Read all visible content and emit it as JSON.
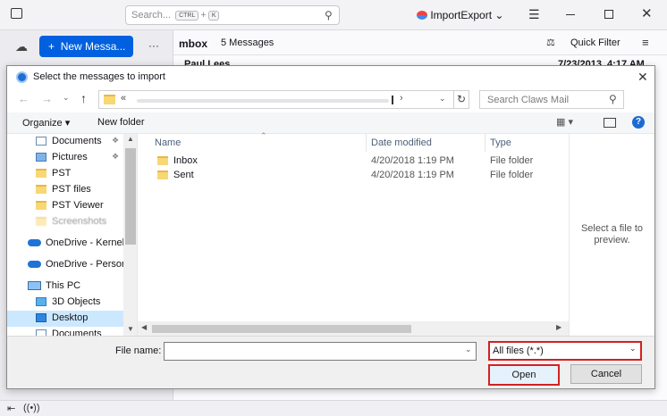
{
  "app": {
    "search_placeholder": "Search...",
    "kbd_ctrl": "CTRL",
    "kbd_plus": "+",
    "kbd_k": "K",
    "account_label": "ImportExport",
    "new_message": "New Messa...",
    "more": "···",
    "folder_name": "mbox",
    "message_count": "5 Messages",
    "quick_filter": "Quick Filter",
    "sender": "Paul Lees",
    "date": "7/23/2013, 4:17 AM"
  },
  "dialog": {
    "title": "Select the messages to import",
    "search_placeholder": "Search Claws Mail",
    "address_prefix": "«",
    "organize": "Organize",
    "new_folder": "New folder",
    "nav_items": [
      {
        "label": "Documents",
        "pinned": "true"
      },
      {
        "label": "Pictures",
        "pinned": "true"
      },
      {
        "label": "PST"
      },
      {
        "label": "PST files"
      },
      {
        "label": "PST Viewer"
      },
      {
        "label": "Screenshots"
      },
      {
        "label": "OneDrive - Kernel"
      },
      {
        "label": "OneDrive - Person"
      },
      {
        "label": "This PC"
      },
      {
        "label": "3D Objects"
      },
      {
        "label": "Desktop"
      },
      {
        "label": "Documents"
      }
    ],
    "columns": {
      "name": "Name",
      "date": "Date modified",
      "type": "Type"
    },
    "files": [
      {
        "name": "Inbox",
        "date": "4/20/2018 1:19 PM",
        "type": "File folder"
      },
      {
        "name": "Sent",
        "date": "4/20/2018 1:19 PM",
        "type": "File folder"
      }
    ],
    "preview_text": "Select a file to preview.",
    "file_name_label": "File name:",
    "file_name_value": "",
    "filter_value": "All files (*.*)",
    "open": "Open",
    "cancel": "Cancel"
  },
  "colors": {
    "accent": "#0060df",
    "highlight": "#d42020",
    "selected": "#cce8ff"
  }
}
